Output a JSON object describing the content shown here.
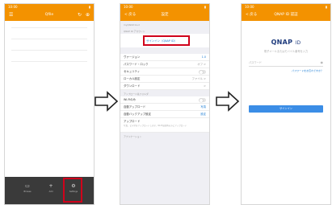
{
  "colors": {
    "accent": "#f39200",
    "highlight": "#d0021b",
    "link": "#1a7cd4",
    "button": "#3b8de6"
  },
  "status": {
    "time": "10:00",
    "battery": "▮▮ ▮"
  },
  "phone1": {
    "title": "Qfile",
    "header_icons": [
      "menu-icon",
      "refresh-icon",
      "add-server-icon",
      "settings-icon"
    ],
    "tabs": [
      {
        "icon": "folder-icon",
        "label": "Browse"
      },
      {
        "icon": "plus-icon",
        "label": "Add"
      },
      {
        "icon": "gear-icon",
        "label": "Settings"
      }
    ]
  },
  "phone2": {
    "back": "< 戻る",
    "title": "設定",
    "sec_account": "myQNAPcloud",
    "sec_qnap_id": "QNAP ID アカウント",
    "signin_link": "サインイン（QNAP ID）",
    "rows_general": [
      {
        "label": "ヴァージョン",
        "value": "1.0"
      },
      {
        "label": "パスワード・ロック",
        "value": "オフ >"
      },
      {
        "label": "セキュリティ",
        "value": ""
      },
      {
        "label": "ローカル設定",
        "value": "ファイル >"
      },
      {
        "label": "ダウンロード",
        "value": ">"
      }
    ],
    "sec_upload": "アップロード先フォルダ",
    "rows_upload": [
      {
        "label": "Wi-Fiのみ",
        "value": ""
      },
      {
        "label": "自動アップロード",
        "value": "写真"
      },
      {
        "label": "自動バックアップ設定",
        "value": "設定"
      }
    ],
    "row_desc_title": "アップロード",
    "row_desc": "写真、ビデオをアップロードします。Wi-Fi接続時のみにアップロード",
    "sec_bottom": "アプリケーション"
  },
  "phone3": {
    "back": "< 戻る",
    "title": "QNAP ID 認証",
    "logo": "QNAP",
    "logo_suffix": "ID",
    "prompt": "電子メールまたはモバイル番号を入力",
    "password_placeholder": "パスワード",
    "forgot": "パスワードをお忘れですか？",
    "signin": "サインイン"
  }
}
